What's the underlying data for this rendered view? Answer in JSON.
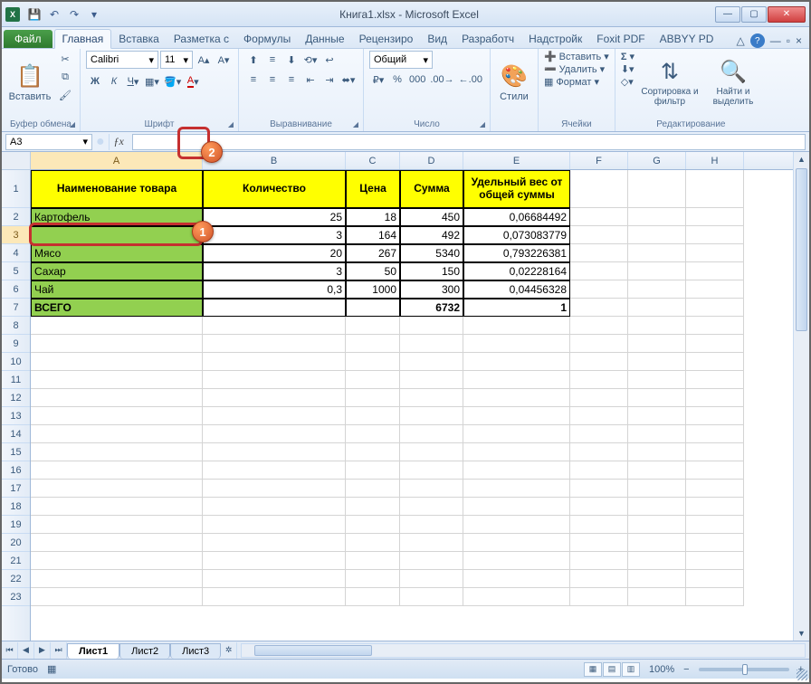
{
  "title": "Книга1.xlsx - Microsoft Excel",
  "qat": {
    "save": "💾",
    "undo": "↶",
    "redo": "↷"
  },
  "tabs": {
    "file": "Файл",
    "list": [
      "Главная",
      "Вставка",
      "Разметка с",
      "Формулы",
      "Данные",
      "Рецензиро",
      "Вид",
      "Разработч",
      "Надстройк",
      "Foxit PDF",
      "ABBYY PD"
    ],
    "active_index": 0
  },
  "ribbon": {
    "clipboard": {
      "paste": "Вставить",
      "label": "Буфер обмена"
    },
    "font": {
      "name": "Calibri",
      "size": "11",
      "label": "Шрифт"
    },
    "alignment": {
      "label": "Выравнивание"
    },
    "number": {
      "format": "Общий",
      "label": "Число"
    },
    "styles": {
      "btn": "Стили",
      "label": ""
    },
    "cells": {
      "insert": "Вставить",
      "delete": "Удалить",
      "format": "Формат",
      "label": "Ячейки"
    },
    "editing": {
      "sort": "Сортировка и фильтр",
      "find": "Найти и выделить",
      "label": "Редактирование"
    }
  },
  "namebox": "A3",
  "columns": [
    "A",
    "B",
    "C",
    "D",
    "E",
    "F",
    "G",
    "H"
  ],
  "col_widths": [
    "cA",
    "cB",
    "cC",
    "cD",
    "cE",
    "cF",
    "cG",
    "cH"
  ],
  "headers": [
    "Наименование товара",
    "Количество",
    "Цена",
    "Сумма",
    "Удельный вес от общей суммы"
  ],
  "rows": [
    {
      "name": "Картофель",
      "qty": "25",
      "price": "18",
      "sum": "450",
      "share": "0,06684492"
    },
    {
      "name": "",
      "qty": "3",
      "price": "164",
      "sum": "492",
      "share": "0,073083779"
    },
    {
      "name": "Мясо",
      "qty": "20",
      "price": "267",
      "sum": "5340",
      "share": "0,793226381"
    },
    {
      "name": "Сахар",
      "qty": "3",
      "price": "50",
      "sum": "150",
      "share": "0,02228164"
    },
    {
      "name": "Чай",
      "qty": "0,3",
      "price": "1000",
      "sum": "300",
      "share": "0,04456328"
    }
  ],
  "total": {
    "label": "ВСЕГО",
    "sum": "6732",
    "share": "1"
  },
  "sheets": [
    "Лист1",
    "Лист2",
    "Лист3"
  ],
  "status": {
    "ready": "Готово",
    "zoom": "100%"
  },
  "badges": {
    "one": "1",
    "two": "2"
  }
}
